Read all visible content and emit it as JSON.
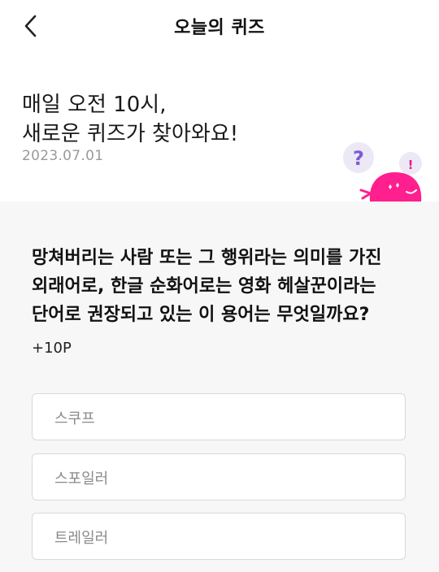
{
  "header": {
    "title": "오늘의 퀴즈",
    "back_icon": "chevron-left-icon"
  },
  "hero": {
    "line1": "매일 오전 10시,",
    "line2": "새로운 퀴즈가 찾아와요!",
    "date": "2023.07.01",
    "illustration": {
      "question_mark": "?",
      "exclamation": "!",
      "colors": {
        "blob": "#ff1f8e",
        "bubble": "#ece8f6",
        "question": "#7b5cd6"
      }
    }
  },
  "quiz": {
    "question": "망쳐버리는 사람 또는 그 행위라는 의미를 가진 외래어로, 한글 순화어로는 영화 헤살꾼이라는 단어로 권장되고 있는 이 용어는 무엇일까요?",
    "points": "+10P",
    "options": [
      {
        "label": "스쿠프"
      },
      {
        "label": "스포일러"
      },
      {
        "label": "트레일러"
      }
    ]
  }
}
